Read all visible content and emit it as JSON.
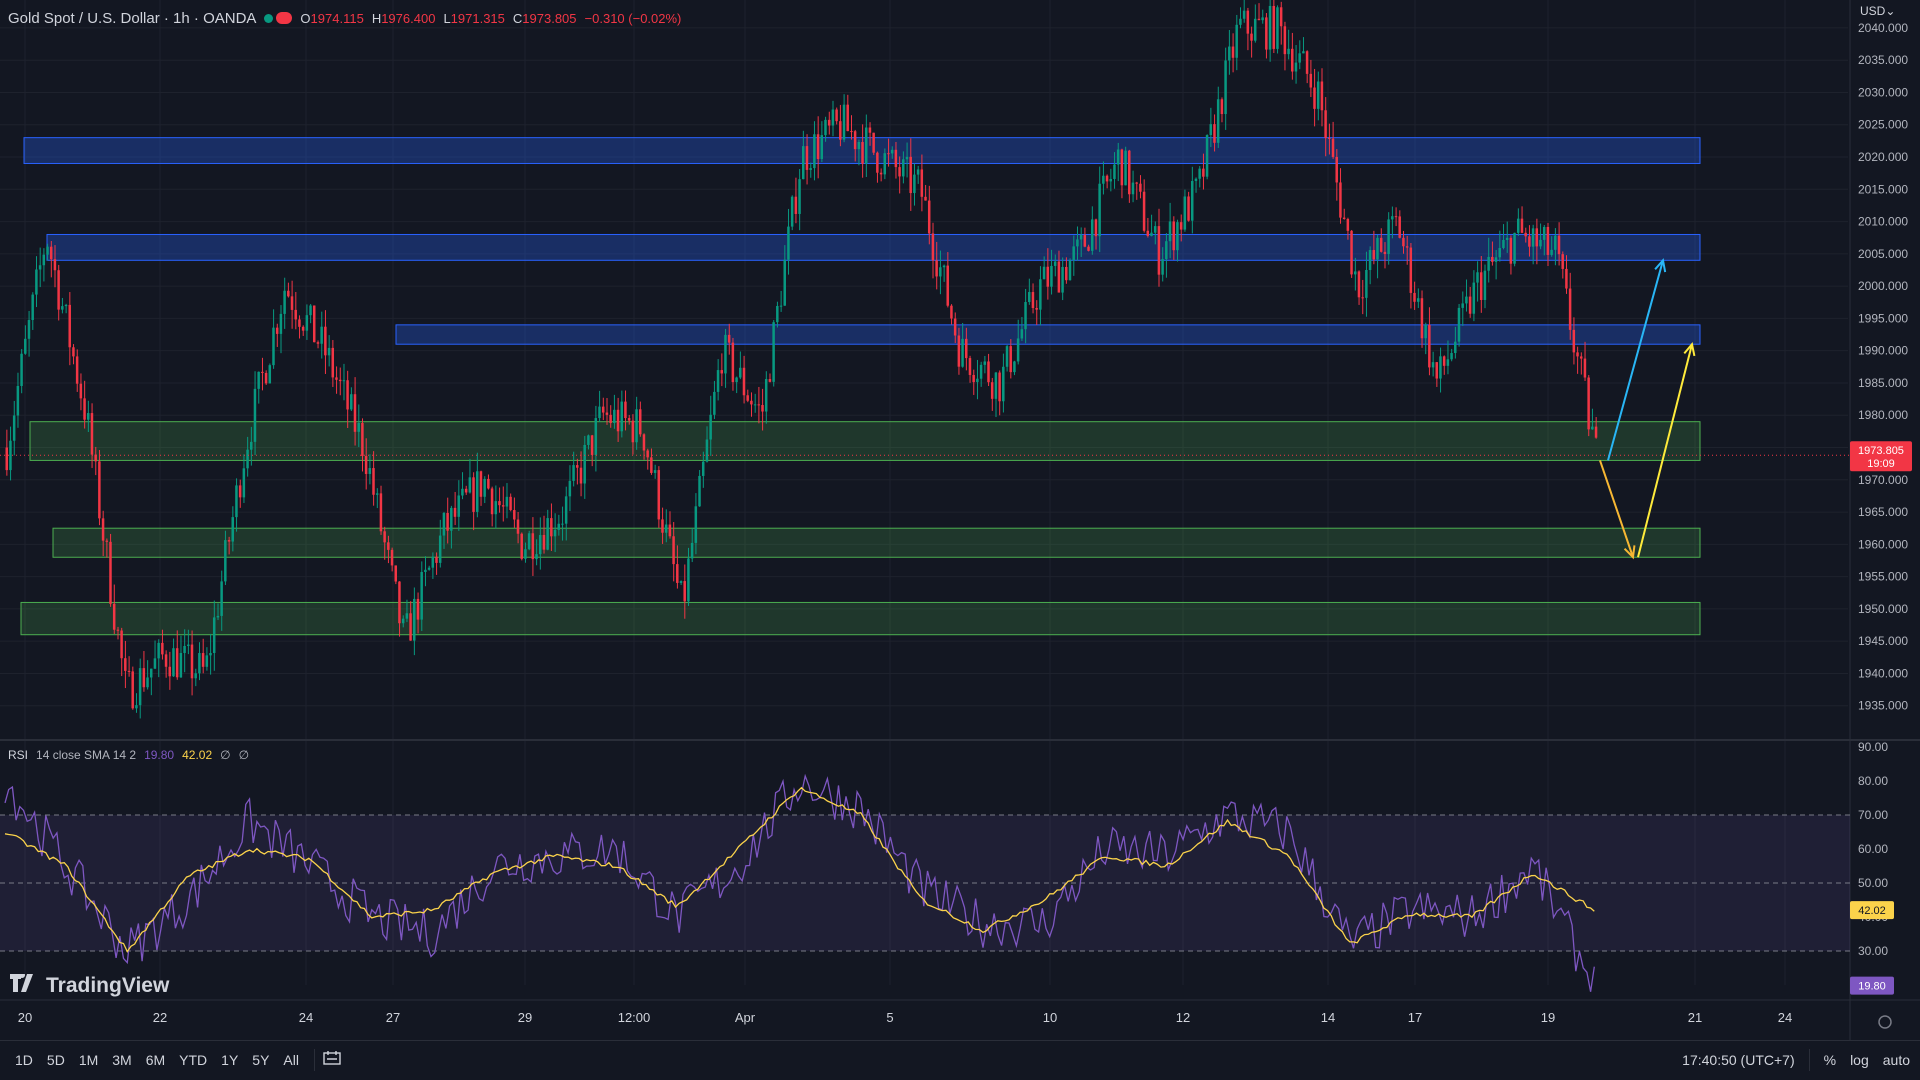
{
  "header": {
    "symbol": "Gold Spot / U.S. Dollar · 1h · OANDA",
    "ohlc": [
      {
        "k": "O",
        "v": "1974.115"
      },
      {
        "k": "H",
        "v": "1976.400"
      },
      {
        "k": "L",
        "v": "1971.315"
      },
      {
        "k": "C",
        "v": "1973.805"
      }
    ],
    "change": "−0.310 (−0.02%)"
  },
  "currency": "USD",
  "price_axis": {
    "min": 1930,
    "max": 2042,
    "ticks": [
      "1935.000",
      "1940.000",
      "1945.000",
      "1950.000",
      "1955.000",
      "1960.000",
      "1965.000",
      "1970.000",
      "1975.000",
      "1980.000",
      "1985.000",
      "1990.000",
      "1995.000",
      "2000.000",
      "2005.000",
      "2010.000",
      "2015.000",
      "2020.000",
      "2025.000",
      "2030.000",
      "2035.000",
      "2040.000"
    ],
    "last_price_label": "1973.805",
    "countdown_label": "19:09",
    "last_price": 1973.805
  },
  "rsi": {
    "legend_name": "RSI",
    "legend_params": "14 close SMA 14 2",
    "value": "19.80",
    "sma_value": "42.02",
    "extra1": "∅",
    "extra2": "∅",
    "axis_ticks": [
      "30.00",
      "40.00",
      "50.00",
      "60.00",
      "70.00",
      "80.00",
      "90.00"
    ],
    "upper_band": 70,
    "lower_band": 30,
    "mid_band": 50
  },
  "time_axis": {
    "labels": [
      "20",
      "22",
      "24",
      "27",
      "29",
      "12:00",
      "Apr",
      "5",
      "10",
      "12",
      "14",
      "17",
      "19",
      "21",
      "24"
    ]
  },
  "watermark": "TradingView",
  "bottom_bar": {
    "timeframes": [
      "1D",
      "5D",
      "1M",
      "3M",
      "6M",
      "YTD",
      "1Y",
      "5Y",
      "All"
    ],
    "clock": "17:40:50 (UTC+7)",
    "pct": "%",
    "log": "log",
    "auto": "auto"
  },
  "chart_data": {
    "type": "candlestick",
    "title": "Gold Spot / U.S. Dollar · 1h · OANDA",
    "y_range": [
      1930,
      2042
    ],
    "zones": [
      {
        "kind": "resistance",
        "low": 2019,
        "high": 2023,
        "color": "#2962ff"
      },
      {
        "kind": "resistance",
        "low": 2004,
        "high": 2008,
        "color": "#2962ff"
      },
      {
        "kind": "resistance",
        "low": 1991,
        "high": 1994,
        "color": "#2962ff"
      },
      {
        "kind": "support",
        "low": 1973,
        "high": 1979,
        "color": "#4caf50"
      },
      {
        "kind": "support",
        "low": 1958,
        "high": 1962.5,
        "color": "#4caf50"
      },
      {
        "kind": "support",
        "low": 1946,
        "high": 1951,
        "color": "#4caf50"
      }
    ],
    "close_path": [
      [
        "20",
        1975
      ],
      [
        "20",
        2008
      ],
      [
        "21",
        1980
      ],
      [
        "22",
        1937
      ],
      [
        "22",
        1943
      ],
      [
        "23",
        1940
      ],
      [
        "24",
        1975
      ],
      [
        "24",
        2000
      ],
      [
        "26",
        1990
      ],
      [
        "27",
        1975
      ],
      [
        "27",
        1945
      ],
      [
        "28",
        1962
      ],
      [
        "29",
        1970
      ],
      [
        "29",
        1960
      ],
      [
        "12:00",
        1965
      ],
      [
        "12:00",
        1980
      ],
      [
        "12:00",
        1978
      ],
      [
        "Apr",
        1950
      ],
      [
        "Apr",
        1990
      ],
      [
        "4",
        1980
      ],
      [
        "5",
        2020
      ],
      [
        "5",
        2025
      ],
      [
        "6",
        2020
      ],
      [
        "8",
        2015
      ],
      [
        "10",
        1990
      ],
      [
        "10",
        1985
      ],
      [
        "11",
        2000
      ],
      [
        "12",
        2005
      ],
      [
        "12",
        2020
      ],
      [
        "13",
        2005
      ],
      [
        "13",
        2015
      ],
      [
        "14",
        2040
      ],
      [
        "14",
        2040
      ],
      [
        "15",
        2030
      ],
      [
        "16",
        2000
      ],
      [
        "17",
        2010
      ],
      [
        "17",
        1985
      ],
      [
        "18",
        2000
      ],
      [
        "19",
        2008
      ],
      [
        "19",
        2005
      ],
      [
        "20",
        1974
      ]
    ],
    "rsi_path": [
      [
        "20",
        80
      ],
      [
        "21",
        55
      ],
      [
        "22",
        30
      ],
      [
        "23",
        45
      ],
      [
        "24",
        68
      ],
      [
        "26",
        55
      ],
      [
        "27",
        40
      ],
      [
        "28",
        35
      ],
      [
        "29",
        55
      ],
      [
        "12:00",
        58
      ],
      [
        "12:00",
        60
      ],
      [
        "Apr",
        40
      ],
      [
        "4",
        55
      ],
      [
        "5",
        80
      ],
      [
        "6",
        72
      ],
      [
        "8",
        48
      ],
      [
        "10",
        38
      ],
      [
        "11",
        38
      ],
      [
        "12",
        60
      ],
      [
        "13",
        58
      ],
      [
        "14",
        70
      ],
      [
        "15",
        65
      ],
      [
        "16",
        32
      ],
      [
        "17",
        42
      ],
      [
        "18",
        40
      ],
      [
        "19",
        55
      ],
      [
        "20",
        20
      ]
    ],
    "rsi_sma_path": [
      [
        "20",
        65
      ],
      [
        "21",
        55
      ],
      [
        "22",
        30
      ],
      [
        "23",
        52
      ],
      [
        "24",
        60
      ],
      [
        "26",
        57
      ],
      [
        "27",
        40
      ],
      [
        "28",
        42
      ],
      [
        "29",
        53
      ],
      [
        "12:00",
        58
      ],
      [
        "12:00",
        55
      ],
      [
        "Apr",
        43
      ],
      [
        "4",
        60
      ],
      [
        "5",
        78
      ],
      [
        "6",
        70
      ],
      [
        "8",
        45
      ],
      [
        "10",
        36
      ],
      [
        "11",
        45
      ],
      [
        "12",
        58
      ],
      [
        "13",
        55
      ],
      [
        "14",
        68
      ],
      [
        "15",
        58
      ],
      [
        "16",
        32
      ],
      [
        "17",
        41
      ],
      [
        "18",
        40
      ],
      [
        "19",
        53
      ],
      [
        "20",
        42
      ]
    ],
    "projection_arrows": [
      {
        "color": "#f7b733",
        "from": 1973,
        "to": 1958
      },
      {
        "color": "#ffeb3b",
        "from": 1958,
        "to": 1991
      },
      {
        "color": "#29b6f6",
        "from": 1973,
        "to": 2004
      }
    ],
    "colors": {
      "up": "#089981",
      "down": "#f23645",
      "rsi": "#7e57c2",
      "sma": "#fbd34b"
    }
  }
}
